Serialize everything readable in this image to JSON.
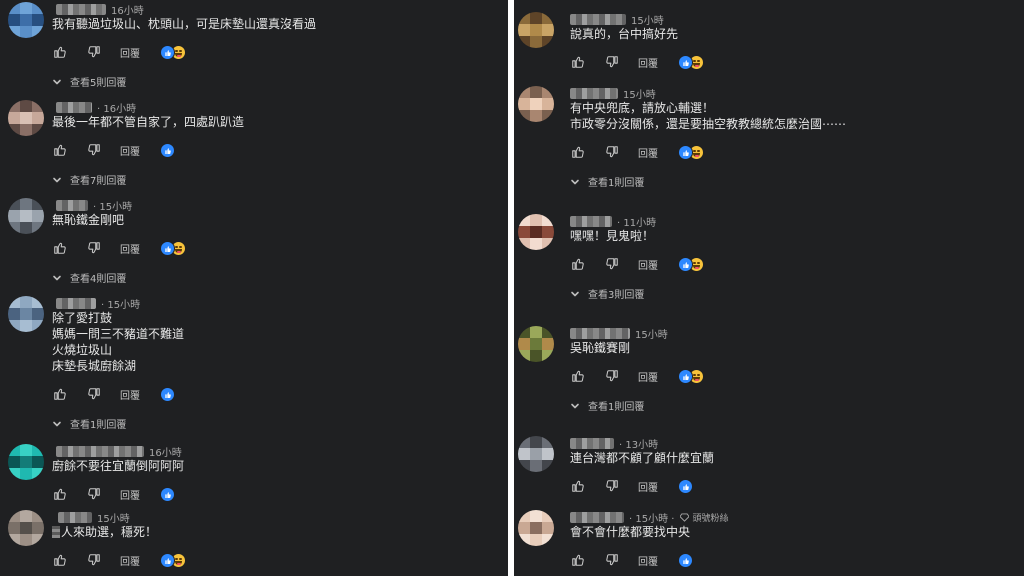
{
  "ui": {
    "reply_label": "回覆",
    "colors": {
      "background": "#1f2022",
      "like_blue": "#2d88ff",
      "haha_yellow": "#f7c33b",
      "text": "#e7e7e7",
      "meta": "#a8a8a8"
    },
    "icons": [
      "thumbs-up-icon",
      "thumbs-down-icon",
      "like-reaction-icon",
      "haha-reaction-icon",
      "chevron-down-icon",
      "diamond-icon"
    ]
  },
  "left": [
    {
      "time": "16小時",
      "lines": [
        "我有聽過垃圾山、枕頭山，可是床墊山還真沒看過"
      ],
      "reactions": [
        "like",
        "haha"
      ],
      "view_replies": "查看5則回覆"
    },
    {
      "time": "· 16小時",
      "lines": [
        "最後一年都不管自家了，四處趴趴造"
      ],
      "reactions": [
        "like"
      ],
      "view_replies": "查看7則回覆"
    },
    {
      "time": "· 15小時",
      "lines": [
        "無恥鐵金剛吧"
      ],
      "reactions": [
        "like",
        "haha"
      ],
      "view_replies": "查看4則回覆"
    },
    {
      "time": "· 15小時",
      "lines": [
        "除了愛打鼓",
        "媽媽一問三不豬道不難道",
        "火燒垃圾山",
        "床墊長城廚餘湖"
      ],
      "reactions": [
        "like"
      ],
      "view_replies": "查看1則回覆"
    },
    {
      "time": "16小時",
      "lines": [
        "廚餘不要往宜蘭倒阿阿阿"
      ],
      "reactions": [
        "like"
      ],
      "view_replies": ""
    },
    {
      "time": "15小時",
      "lines": [
        "人來助選，穩死！"
      ],
      "reactions": [
        "like",
        "haha"
      ],
      "view_replies": ""
    }
  ],
  "right": [
    {
      "time": "15小時",
      "lines": [
        "說真的，台中搞好先"
      ],
      "reactions": [
        "like",
        "haha"
      ],
      "view_replies": "",
      "badge": ""
    },
    {
      "time": "15小時",
      "lines": [
        "有中央兜底，請放心輔選！",
        "市政零分沒關係，還是要抽空教教總統怎麼治國⋯⋯"
      ],
      "reactions": [
        "like",
        "haha"
      ],
      "view_replies": "查看1則回覆",
      "badge": ""
    },
    {
      "time": "· 11小時",
      "lines": [
        "嘿嘿！見鬼啦！"
      ],
      "reactions": [
        "like",
        "haha"
      ],
      "view_replies": "查看3則回覆",
      "badge": ""
    },
    {
      "time": "15小時",
      "lines": [
        "吳恥鐵賽剛"
      ],
      "reactions": [
        "like",
        "haha"
      ],
      "view_replies": "查看1則回覆",
      "badge": ""
    },
    {
      "time": "· 13小時",
      "lines": [
        "連台灣都不顧了顧什麼宜蘭"
      ],
      "reactions": [
        "like"
      ],
      "view_replies": "",
      "badge": ""
    },
    {
      "time": "· 15小時 ·",
      "lines": [
        "會不會什麼都要找中央"
      ],
      "reactions": [
        "like"
      ],
      "view_replies": "",
      "badge": "頭號粉絲"
    }
  ]
}
